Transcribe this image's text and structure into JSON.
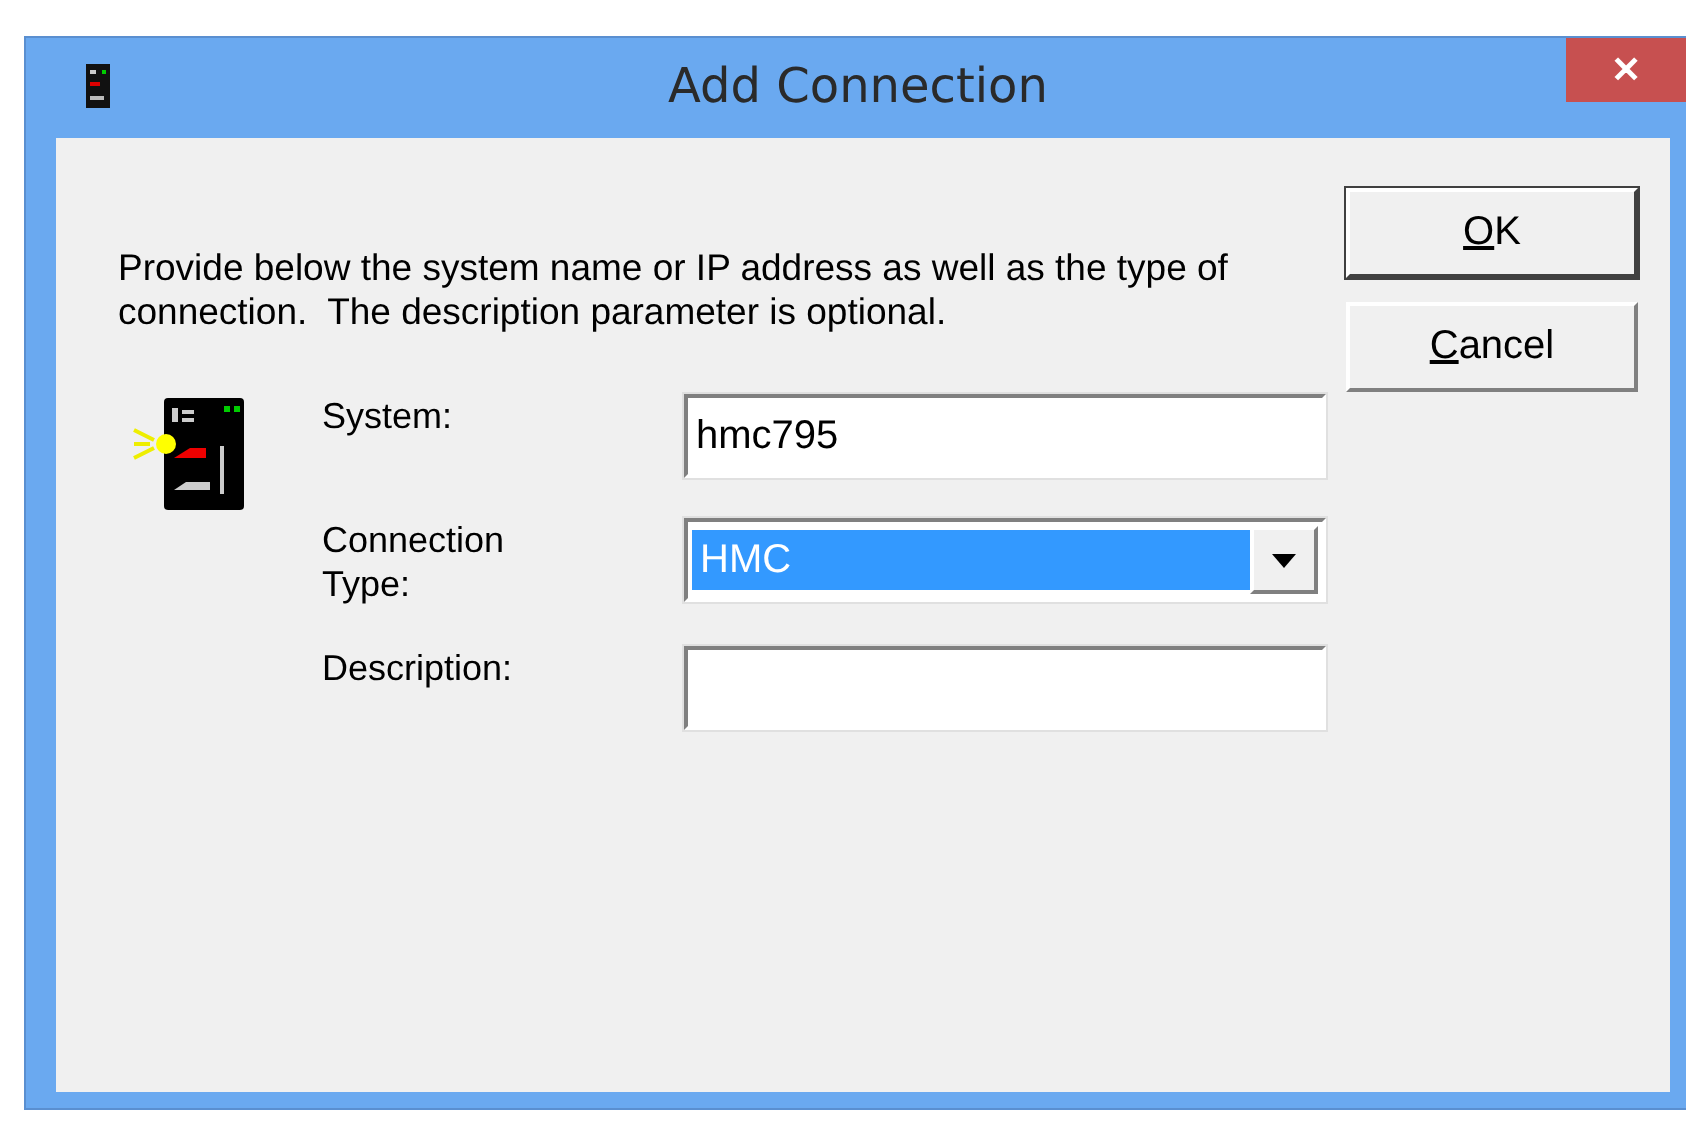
{
  "window": {
    "title": "Add Connection",
    "close": "✕"
  },
  "instructions": "Provide below the system name or IP address as well as the type of connection.  The description parameter is optional.",
  "fields": [
    {
      "kind": "text",
      "label": "System:",
      "value": "hmc795"
    },
    {
      "kind": "combo",
      "label": "Connection Type:",
      "value": "HMC",
      "selected": true
    },
    {
      "kind": "text",
      "label": "Description:"
    }
  ],
  "buttons": [
    {
      "label": "OK",
      "underline_first": true,
      "default": true
    },
    {
      "label": "Cancel",
      "underline_first": true,
      "default": false
    }
  ]
}
